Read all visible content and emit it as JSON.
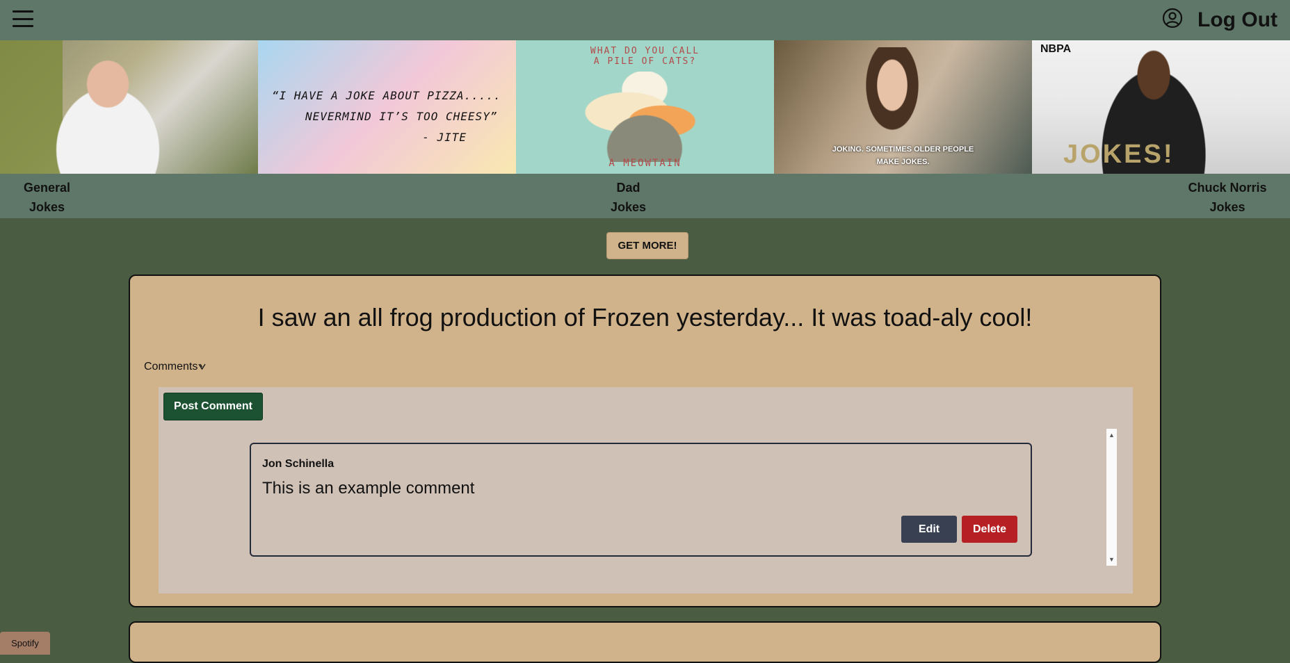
{
  "header": {
    "menu_icon": "hamburger-menu-icon",
    "account_icon": "user-circle-icon",
    "logout_label": "Log Out"
  },
  "banner": {
    "panel2_quote": [
      "“I HAVE A JOKE ABOUT PIZZA.....",
      "NEVERMIND IT’S TOO CHEESY”",
      "- JITE"
    ],
    "panel3_top": [
      "WHAT DO YOU CALL",
      "A PILE OF CATS?"
    ],
    "panel3_bottom": "A MEOWTAIN",
    "panel4_subtitle": [
      "JOKING. SOMETIMES OLDER PEOPLE",
      "MAKE JOKES."
    ],
    "panel5_logo": "NBPA",
    "panel5_text": "JOKES!"
  },
  "categories": {
    "general": [
      "General",
      "Jokes"
    ],
    "dad": [
      "Dad",
      "Jokes"
    ],
    "chuck": [
      "Chuck Norris",
      "Jokes"
    ]
  },
  "get_more_label": "GET MORE!",
  "joke": {
    "text": "I saw an all frog production of Frozen yesterday... It was toad-aly cool!",
    "comments_label": "Comments",
    "post_comment_label": "Post Comment",
    "comment": {
      "author": "Jon Schinella",
      "text": "This is an example comment",
      "edit_label": "Edit",
      "delete_label": "Delete"
    }
  },
  "footer": {
    "spotify_label": "Spotify"
  },
  "colors": {
    "background": "#4a5c41",
    "header": "#5f7768",
    "card": "#d1b38b",
    "comment_area": "#d0c1b6",
    "post_button": "#1c5232",
    "edit_button": "#384052",
    "delete_button": "#b61f24"
  }
}
